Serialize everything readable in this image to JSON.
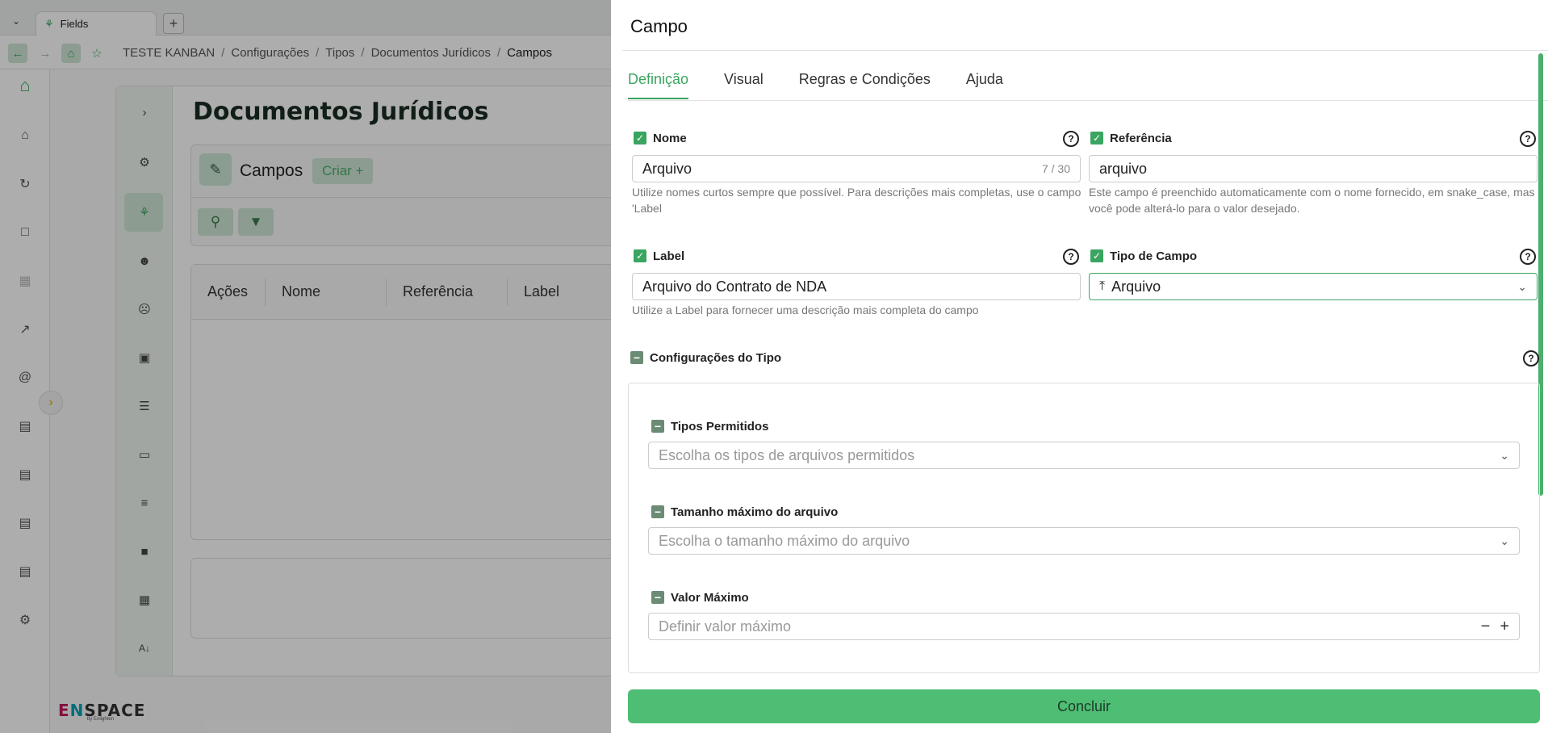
{
  "browser": {
    "tab_title": "Fields",
    "breadcrumb": [
      "TESTE KANBAN",
      "Configurações",
      "Tipos",
      "Documentos Jurídicos",
      "Campos"
    ]
  },
  "background": {
    "page_title": "Documentos Jurídicos",
    "campos_label": "Campos",
    "criar_label": "Criar +",
    "table_headers": [
      "Ações",
      "Nome",
      "Referência",
      "Label"
    ],
    "logo_text": "ENSPACE",
    "logo_sub": "by Enlighten"
  },
  "drawer": {
    "title": "Campo",
    "tabs": [
      "Definição",
      "Visual",
      "Regras e Condições",
      "Ajuda"
    ],
    "active_tab": "Definição",
    "nome": {
      "label": "Nome",
      "value": "Arquivo",
      "counter": "7 / 30",
      "hint": "Utilize nomes curtos sempre que possível. Para descrições mais completas, use o campo 'Label"
    },
    "referencia": {
      "label": "Referência",
      "value": "arquivo",
      "hint": "Este campo é preenchido automaticamente com o nome fornecido, em snake_case, mas você pode alterá-lo para o valor desejado."
    },
    "label_field": {
      "label": "Label",
      "value": "Arquivo do Contrato de NDA",
      "hint": "Utilize a Label para fornecer uma descrição mais completa do campo"
    },
    "tipo_campo": {
      "label": "Tipo de Campo",
      "value": "Arquivo"
    },
    "config_tipo": {
      "label": "Configurações do Tipo",
      "tipos_permitidos": {
        "label": "Tipos Permitidos",
        "placeholder": "Escolha os tipos de arquivos permitidos"
      },
      "tamanho_maximo": {
        "label": "Tamanho máximo do arquivo",
        "placeholder": "Escolha o tamanho máximo do arquivo"
      },
      "valor_maximo": {
        "label": "Valor Máximo",
        "placeholder": "Definir valor máximo"
      }
    },
    "conclude_label": "Concluir"
  },
  "colors": {
    "accent": "#3aa561",
    "button": "#4ebe74"
  }
}
